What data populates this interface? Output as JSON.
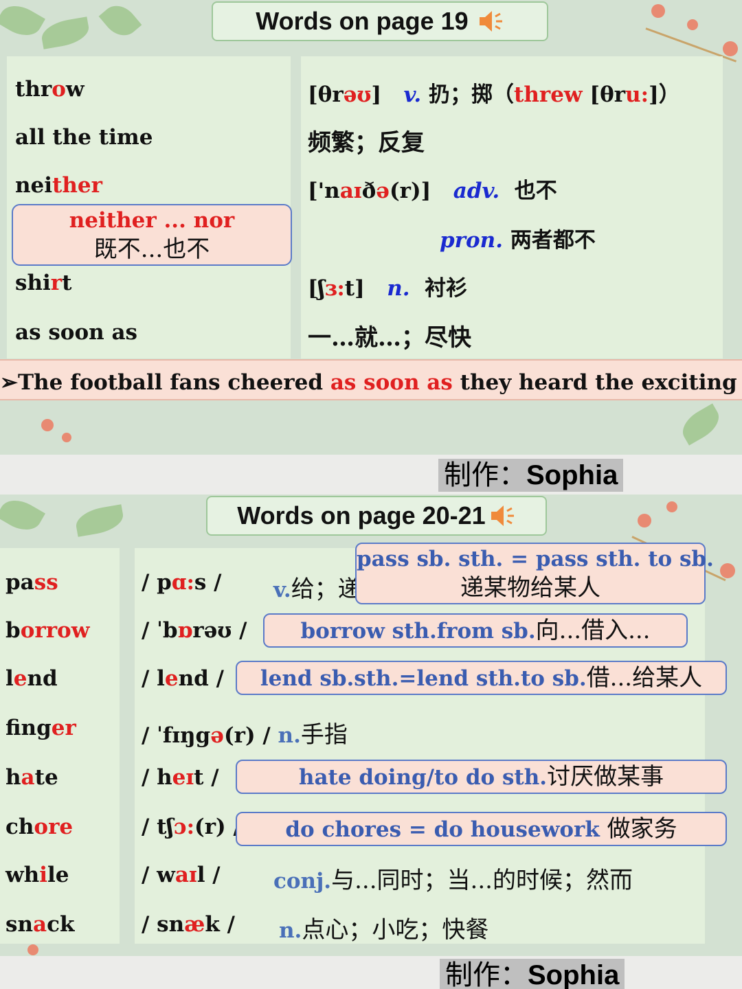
{
  "slide1": {
    "title": "Words on page 19",
    "words": [
      {
        "pre": "thr",
        "hl": "o",
        "post": "w"
      },
      {
        "pre": "all the time",
        "hl": "",
        "post": ""
      },
      {
        "pre": "nei",
        "hl": "th",
        "post": "",
        "hl2": "er"
      },
      {
        "pre": "shi",
        "hl": "r",
        "post": "t"
      },
      {
        "pre": "as soon as",
        "hl": "",
        "post": ""
      }
    ],
    "callout": {
      "phrase": "neither ... nor",
      "meaning": "既不...也不"
    },
    "defs": {
      "throw": {
        "phon_a": "[θr",
        "phon_b": "əʊ",
        "phon_c": "]",
        "pos": "v.",
        "cn": "扔；掷（",
        "past": "threw",
        "phon2_a": "[θr",
        "phon2_b": "u:",
        "phon2_c": "]",
        "close": "）"
      },
      "all_the_time": "频繁；反复",
      "neither": {
        "phon_a": "['n",
        "phon_b": "aɪ",
        "phon_c": "ð",
        "phon_d": "ə",
        "phon_e": "(r)]",
        "pos": "adv.",
        "cn": "也不"
      },
      "neither_pron": {
        "pos": "pron.",
        "cn": "两者都不"
      },
      "shirt": {
        "phon_a": "[ʃ",
        "phon_b": "ɜ:",
        "phon_c": "t]",
        "pos": "n.",
        "cn": "衬衫"
      },
      "as_soon_as": "一…就…；尽快"
    },
    "example": {
      "arrow": "➢",
      "pre": "The football fans cheered ",
      "hl": "as soon as",
      "post": " they heard the exciting new"
    }
  },
  "credit": {
    "label": "制作：",
    "name": "Sophia"
  },
  "slide2": {
    "title": "Words on page 20-21",
    "rows": [
      {
        "word_pre": "pa",
        "word_hl": "ss",
        "word_post": "",
        "phon_pre": "/ p",
        "phon_hl": "ɑ:",
        "phon_post": "s /"
      },
      {
        "word_pre": "b",
        "word_hl": "orrow",
        "word_post": "",
        "phon_pre": "/ ˈb",
        "phon_hl": "ɒ",
        "phon_post": "rəʊ /"
      },
      {
        "word_pre": "l",
        "word_hl": "e",
        "word_post": "nd",
        "phon_pre": "/ l",
        "phon_hl": "e",
        "phon_post": "nd /"
      },
      {
        "word_pre": "fing",
        "word_hl": "er",
        "word_post": "",
        "phon_pre": "/ ˈfɪŋg",
        "phon_hl": "ə",
        "phon_post": "(r) /"
      },
      {
        "word_pre": "h",
        "word_hl": "a",
        "word_post": "te",
        "phon_pre": "/ h",
        "phon_hl": "eɪ",
        "phon_post": "t /"
      },
      {
        "word_pre": "ch",
        "word_hl": "ore",
        "word_post": "",
        "phon_pre": "/ tʃ",
        "phon_hl": "ɔ:",
        "phon_post": "(r) /"
      },
      {
        "word_pre": "wh",
        "word_hl": "i",
        "word_post": "le",
        "phon_pre": "/ w",
        "phon_hl": "aɪ",
        "phon_post": "l /"
      },
      {
        "word_pre": "sn",
        "word_hl": "a",
        "word_post": "ck",
        "phon_pre": "/ sn",
        "phon_hl": "æ",
        "phon_post": "k /"
      }
    ],
    "pass_def": {
      "pos": "v.",
      "cn": "给；递"
    },
    "finger_def": {
      "pos": "n.",
      "cn": "手指"
    },
    "while_def": {
      "pos": "conj.",
      "cn": "与...同时；当...的时候；然而"
    },
    "snack_def": {
      "pos": "n.",
      "cn": "点心；小吃；快餐"
    },
    "callouts": {
      "pass": {
        "en": "pass sb. sth. = pass sth. to sb.",
        "cn": "递某物给某人"
      },
      "borrow": {
        "en": "borrow sth.from sb.",
        "cn": "向...借入..."
      },
      "lend": {
        "en": "lend sb.sth.=lend sth.to sb.",
        "cn": "借...给某人"
      },
      "hate": {
        "en": "hate doing/to do sth.",
        "cn": "讨厌做某事"
      },
      "chore": {
        "en": "do chores = do housework ",
        "cn": "做家务"
      }
    }
  },
  "colors": {
    "accent_red": "#e02020",
    "pos_blue": "#1a2ad0",
    "steel_blue": "#4a70b8",
    "callout_fill": "#fae0d6"
  }
}
